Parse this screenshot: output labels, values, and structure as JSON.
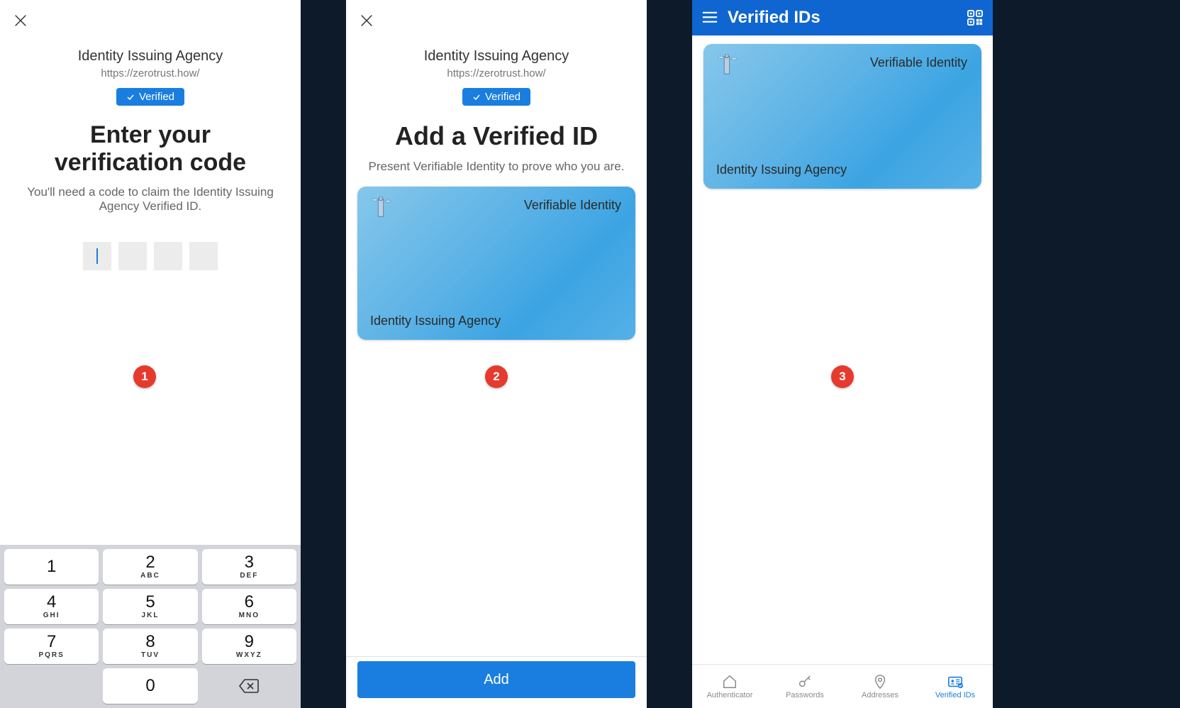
{
  "issuer": {
    "name": "Identity Issuing Agency",
    "url": "https://zerotrust.how/",
    "verified_label": "Verified"
  },
  "card": {
    "kind": "Verifiable Identity",
    "issuer": "Identity Issuing Agency"
  },
  "screen1": {
    "title": "Enter your verification code",
    "subhead": "You'll need a code to claim the Identity Issuing Agency Verified ID.",
    "keypad": [
      {
        "d": "1",
        "s": ""
      },
      {
        "d": "2",
        "s": "ABC"
      },
      {
        "d": "3",
        "s": "DEF"
      },
      {
        "d": "4",
        "s": "GHI"
      },
      {
        "d": "5",
        "s": "JKL"
      },
      {
        "d": "6",
        "s": "MNO"
      },
      {
        "d": "7",
        "s": "PQRS"
      },
      {
        "d": "8",
        "s": "TUV"
      },
      {
        "d": "9",
        "s": "WXYZ"
      },
      {
        "d": "0",
        "s": ""
      }
    ]
  },
  "screen2": {
    "title": "Add a Verified ID",
    "subhead": "Present Verifiable Identity to prove who you are.",
    "add_label": "Add"
  },
  "screen3": {
    "topbar_title": "Verified IDs",
    "tabs": [
      {
        "label": "Authenticator"
      },
      {
        "label": "Passwords"
      },
      {
        "label": "Addresses"
      },
      {
        "label": "Verified IDs"
      }
    ],
    "active_tab": 3
  },
  "step_badges": [
    "1",
    "2",
    "3"
  ]
}
